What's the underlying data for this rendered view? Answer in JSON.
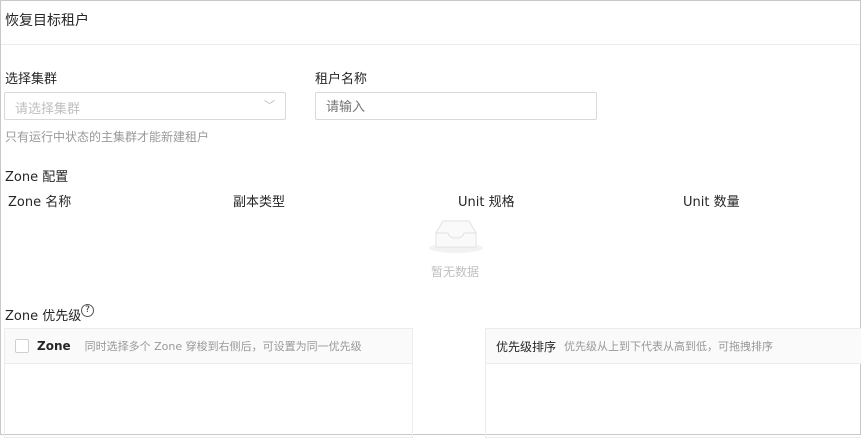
{
  "title": "恢复目标租户",
  "cluster": {
    "label": "选择集群",
    "placeholder": "请选择集群",
    "hint": "只有运行中状态的主集群才能新建租户"
  },
  "tenant": {
    "label": "租户名称",
    "placeholder": "请输入"
  },
  "zone_config": {
    "title": "Zone 配置",
    "columns": [
      "Zone 名称",
      "副本类型",
      "Unit 规格",
      "Unit 数量"
    ],
    "empty": "暂无数据"
  },
  "zone_priority": {
    "title": "Zone 优先级",
    "left_header": "Zone",
    "left_hint": "同时选择多个 Zone 穿梭到右侧后，可设置为同一优先级",
    "right_header": "优先级排序",
    "right_hint": "优先级从上到下代表从高到低，可拖拽排序"
  }
}
